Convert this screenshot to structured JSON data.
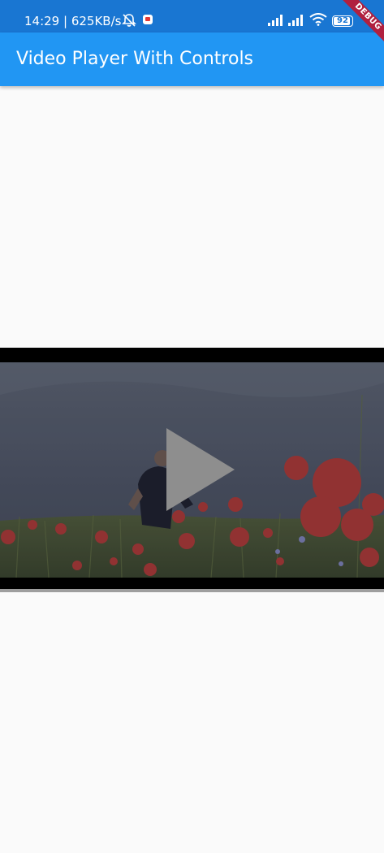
{
  "status_bar": {
    "time_and_speed": "14:29 | 625KB/s",
    "battery_level": "92",
    "background_color": "#1976d2",
    "icons": [
      "mute-icon",
      "app-notification-icon",
      "signal-icon",
      "signal-icon",
      "wifi-icon",
      "battery-icon"
    ]
  },
  "app_bar": {
    "title": "Video Player With Controls",
    "background_color": "#2196f3"
  },
  "debug_banner": {
    "label": "DEBUG",
    "color": "#b0203f"
  },
  "video_player": {
    "state": "paused",
    "controls": [
      "play-icon"
    ]
  }
}
